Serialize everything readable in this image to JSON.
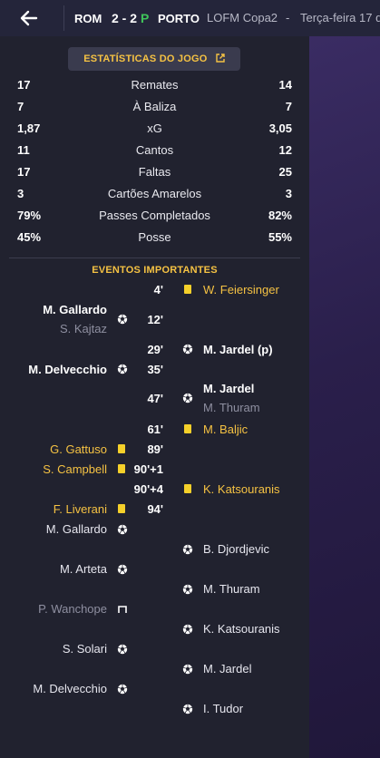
{
  "header": {
    "home_team": "ROM",
    "score": "2 - 2",
    "penalty_marker": "P",
    "away_team": "PORTO",
    "competition": "LOFM Copa2",
    "separator": "-",
    "date": "Terça-feira 17 d"
  },
  "stats_button": {
    "label": "ESTATÍSTICAS DO JOGO"
  },
  "stats": [
    {
      "home": "17",
      "label": "Remates",
      "away": "14"
    },
    {
      "home": "7",
      "label": "À Baliza",
      "away": "7"
    },
    {
      "home": "1,87",
      "label": "xG",
      "away": "3,05"
    },
    {
      "home": "11",
      "label": "Cantos",
      "away": "12"
    },
    {
      "home": "17",
      "label": "Faltas",
      "away": "25"
    },
    {
      "home": "3",
      "label": "Cartões Amarelos",
      "away": "3"
    },
    {
      "home": "79%",
      "label": "Passes Completados",
      "away": "82%"
    },
    {
      "home": "45%",
      "label": "Posse",
      "away": "55%"
    }
  ],
  "events_title": "EVENTOS IMPORTANTES",
  "events": [
    {
      "minute": "4'",
      "side": "away",
      "type": "yellow-card",
      "player": "W. Feiersinger"
    },
    {
      "minute": "12'",
      "side": "home",
      "type": "goal",
      "player": "M. Gallardo",
      "assist": "S. Kajtaz"
    },
    {
      "minute": "29'",
      "side": "away",
      "type": "goal",
      "player": "M. Jardel (p)"
    },
    {
      "minute": "35'",
      "side": "home",
      "type": "goal",
      "player": "M. Delvecchio"
    },
    {
      "minute": "47'",
      "side": "away",
      "type": "goal",
      "player": "M. Jardel",
      "assist": "M. Thuram"
    },
    {
      "minute": "61'",
      "side": "away",
      "type": "yellow-card",
      "player": "M. Baljic"
    },
    {
      "minute": "89'",
      "side": "home",
      "type": "yellow-card",
      "player": "G. Gattuso"
    },
    {
      "minute": "90'+1",
      "side": "home",
      "type": "yellow-card",
      "player": "S. Campbell"
    },
    {
      "minute": "90'+4",
      "side": "away",
      "type": "yellow-card",
      "player": "K. Katsouranis"
    },
    {
      "minute": "94'",
      "side": "home",
      "type": "yellow-card",
      "player": "F. Liverani"
    }
  ],
  "penalties": [
    {
      "side": "home",
      "result": "scored",
      "player": "M. Gallardo"
    },
    {
      "side": "away",
      "result": "scored",
      "player": "B. Djordjevic"
    },
    {
      "side": "home",
      "result": "scored",
      "player": "M. Arteta"
    },
    {
      "side": "away",
      "result": "scored",
      "player": "M. Thuram"
    },
    {
      "side": "home",
      "result": "missed",
      "player": "P. Wanchope"
    },
    {
      "side": "away",
      "result": "scored",
      "player": "K. Katsouranis"
    },
    {
      "side": "home",
      "result": "scored",
      "player": "S. Solari"
    },
    {
      "side": "away",
      "result": "scored",
      "player": "M. Jardel"
    },
    {
      "side": "home",
      "result": "scored",
      "player": "M. Delvecchio"
    },
    {
      "side": "away",
      "result": "scored",
      "player": "I. Tudor"
    }
  ],
  "colors": {
    "accent_yellow": "#f5c243",
    "penalty_green": "#3fc45a",
    "panel_bg": "#21222f",
    "topbar_bg": "#24253a"
  }
}
